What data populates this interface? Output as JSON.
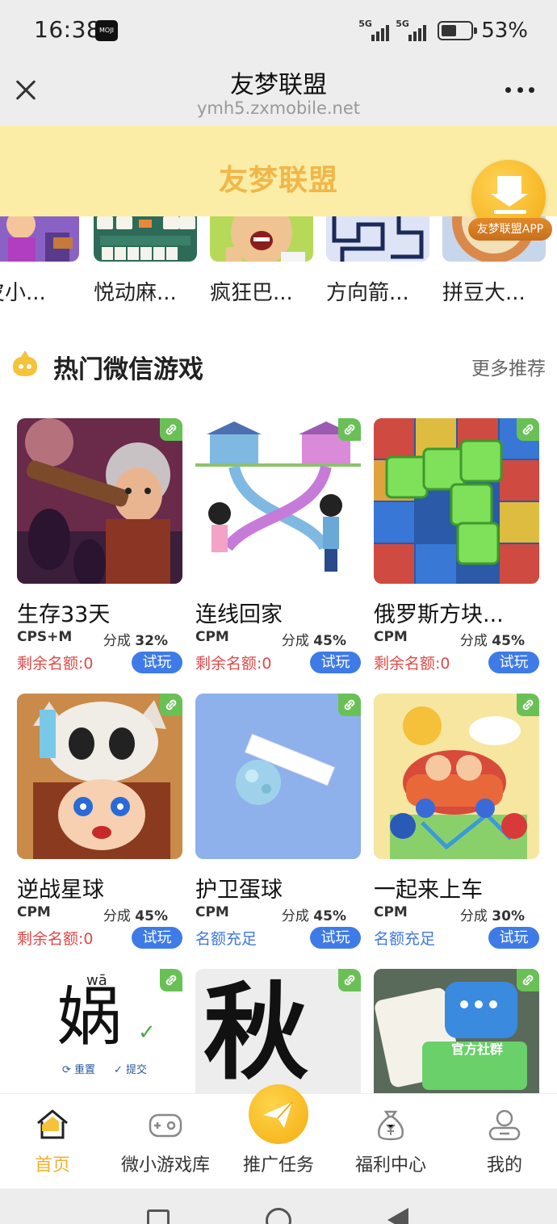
{
  "status_bar": {
    "time": "16:38",
    "app_badge": "MOJI",
    "signal_1": "5G",
    "signal_2": "5G",
    "battery": "53%"
  },
  "title_bar": {
    "title": "友梦联盟",
    "url": "ymh5.zxmobile.net"
  },
  "brand": {
    "title": "友梦联盟",
    "download_label": "友梦联盟APP"
  },
  "recent_games": [
    {
      "name": "皮小..."
    },
    {
      "name": "悦动麻..."
    },
    {
      "name": "疯狂巴..."
    },
    {
      "name": "方向箭..."
    },
    {
      "name": "拼豆大..."
    }
  ],
  "section": {
    "title": "热门微信游戏",
    "more": "更多推荐"
  },
  "games": [
    {
      "name": "生存33天",
      "model": "CPS+M",
      "share_label": "分成",
      "share": "32%",
      "quota": "剩余名额:0",
      "quota_status": "exhausted",
      "button": "试玩"
    },
    {
      "name": "连线回家",
      "model": "CPM",
      "share_label": "分成",
      "share": "45%",
      "quota": "剩余名额:0",
      "quota_status": "exhausted",
      "button": "试玩"
    },
    {
      "name": "俄罗斯方块...",
      "model": "CPM",
      "share_label": "分成",
      "share": "45%",
      "quota": "剩余名额:0",
      "quota_status": "exhausted",
      "button": "试玩"
    },
    {
      "name": "逆战星球",
      "model": "CPM",
      "share_label": "分成",
      "share": "45%",
      "quota": "剩余名额:0",
      "quota_status": "exhausted",
      "button": "试玩"
    },
    {
      "name": "护卫蛋球",
      "model": "CPM",
      "share_label": "分成",
      "share": "45%",
      "quota": "名额充足",
      "quota_status": "available",
      "button": "试玩"
    },
    {
      "name": "一起来上车",
      "model": "CPM",
      "share_label": "分成",
      "share": "30%",
      "quota": "名额充足",
      "quota_status": "available",
      "button": "试玩"
    }
  ],
  "partial_thumbs": {
    "char_pinyin": "wā",
    "char": "娲",
    "reset": "重置",
    "submit": "提交",
    "char2": "秋",
    "community": "官方社群"
  },
  "bottom_nav": [
    {
      "label": "首页",
      "icon": "home-icon",
      "active": true
    },
    {
      "label": "微小游戏库",
      "icon": "gamepad-icon",
      "active": false
    },
    {
      "label": "推广任务",
      "icon": "paper-plane-icon",
      "active": false
    },
    {
      "label": "福利中心",
      "icon": "money-bag-icon",
      "active": false
    },
    {
      "label": "我的",
      "icon": "user-icon",
      "active": false
    }
  ],
  "colors": {
    "brand_yellow": "#f1b64a",
    "header_bg": "#fbeda6",
    "button_blue": "#3f7be6",
    "quota_red": "#e04a48",
    "quota_blue": "#3f78e0",
    "link_green": "#69c155"
  }
}
